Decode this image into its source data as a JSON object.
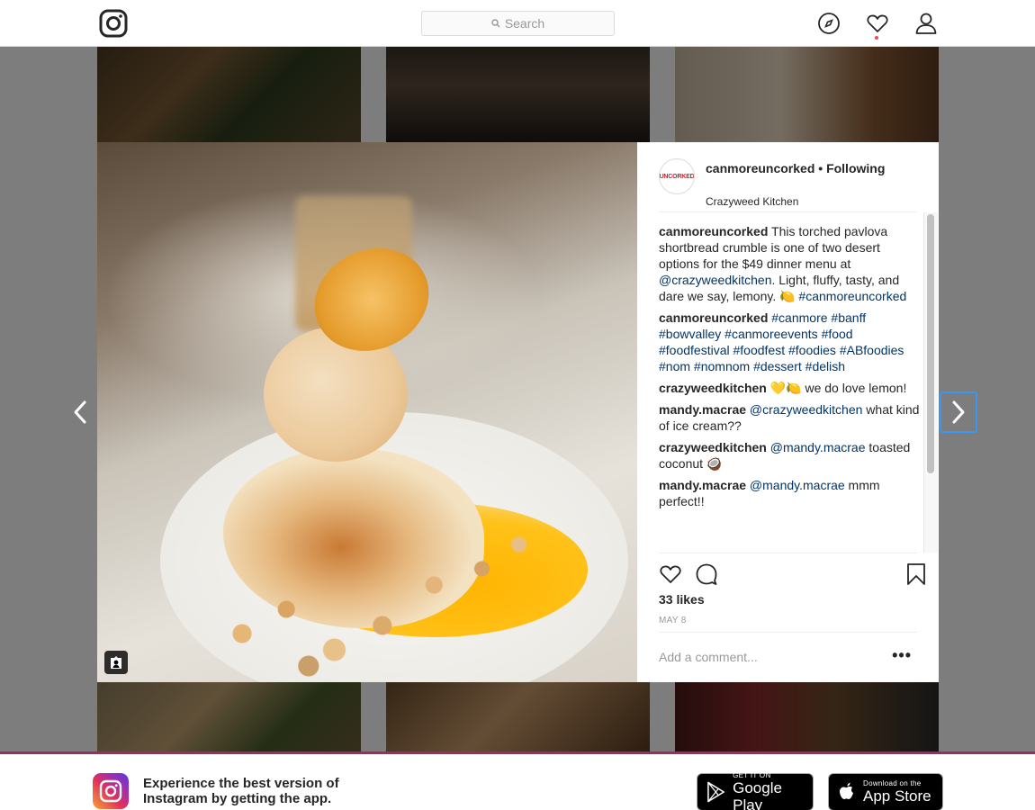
{
  "nav": {
    "search_placeholder": "Search"
  },
  "post": {
    "username": "canmoreuncorked",
    "follow_separator": "•",
    "follow_status": "Following",
    "location": "Crazyweed Kitchen",
    "avatar_text": "UNCORKED",
    "likes": "33 likes",
    "date": "MAY 8",
    "add_comment_placeholder": "Add a comment...",
    "more_label": "•••"
  },
  "comments": [
    {
      "user": "canmoreuncorked",
      "parts": [
        {
          "t": "This torched pavlova shortbread crumble is one of two desert options for the $49 dinner menu at "
        },
        {
          "t": "@crazyweedkitchen",
          "link": true
        },
        {
          "t": ". Light, fluffy, tasty, and dare we say, lemony. 🍋 "
        },
        {
          "t": "#canmoreuncorked",
          "link": true
        }
      ]
    },
    {
      "user": "canmoreuncorked",
      "parts": [
        {
          "t": "#canmore",
          "link": true
        },
        {
          "t": " "
        },
        {
          "t": "#banff",
          "link": true
        },
        {
          "t": " "
        },
        {
          "t": "#bowvalley",
          "link": true
        },
        {
          "t": " "
        },
        {
          "t": "#canmoreevents",
          "link": true
        },
        {
          "t": " "
        },
        {
          "t": "#food",
          "link": true
        },
        {
          "t": " "
        },
        {
          "t": "#foodfestival",
          "link": true
        },
        {
          "t": " "
        },
        {
          "t": "#foodfest",
          "link": true
        },
        {
          "t": " "
        },
        {
          "t": "#foodies",
          "link": true
        },
        {
          "t": " "
        },
        {
          "t": "#ABfoodies",
          "link": true
        },
        {
          "t": " "
        },
        {
          "t": "#nom",
          "link": true
        },
        {
          "t": " "
        },
        {
          "t": "#nomnom",
          "link": true
        },
        {
          "t": " "
        },
        {
          "t": "#dessert",
          "link": true
        },
        {
          "t": " "
        },
        {
          "t": "#delish",
          "link": true
        }
      ]
    },
    {
      "user": "crazyweedkitchen",
      "parts": [
        {
          "t": "💛🍋 we do love lemon!"
        }
      ]
    },
    {
      "user": "mandy.macrae",
      "parts": [
        {
          "t": "@crazyweedkitchen",
          "link": true
        },
        {
          "t": " what kind of ice cream??"
        }
      ]
    },
    {
      "user": "crazyweedkitchen",
      "parts": [
        {
          "t": "@mandy.macrae",
          "link": true
        },
        {
          "t": " toasted coconut 🥥"
        }
      ]
    },
    {
      "user": "mandy.macrae",
      "parts": [
        {
          "t": "@mandy.macrae",
          "link": true
        },
        {
          "t": " mmm perfect!!"
        }
      ]
    }
  ],
  "banner": {
    "line1": "Experience the best version of",
    "line2": "Instagram by getting the app.",
    "google_small": "GET IT ON",
    "google_big": "Google Play",
    "apple_small": "Download on the",
    "apple_big": "App Store"
  },
  "colors": {
    "link": "#003569",
    "accent_focus": "#3897f0",
    "notification": "#ed4956",
    "banner_border": "#9b2c64"
  },
  "icons": {
    "logo": "instagram-logo-icon",
    "search": "search-icon",
    "explore": "compass-icon",
    "activity": "heart-icon",
    "profile": "person-icon",
    "prev": "chevron-left-icon",
    "next": "chevron-right-icon",
    "like": "heart-outline-icon",
    "comment": "comment-icon",
    "save": "bookmark-icon",
    "tagged": "user-tag-icon"
  }
}
